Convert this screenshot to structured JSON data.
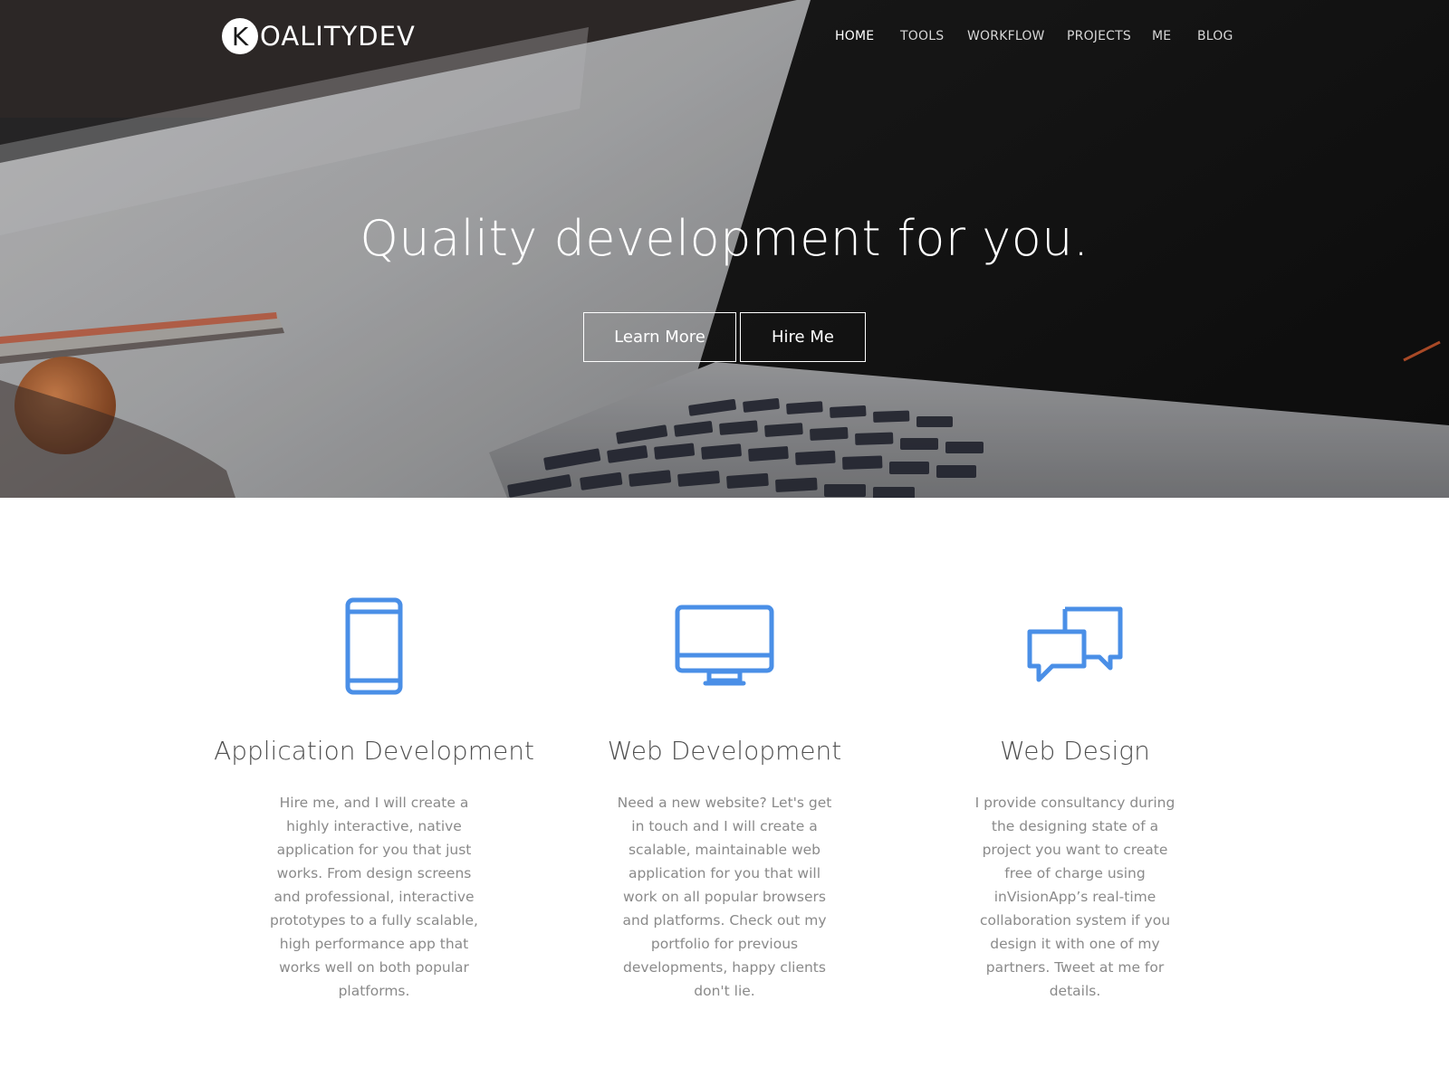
{
  "brand": {
    "logo_letter": "K",
    "logo_text": "OALITYDEV"
  },
  "nav": {
    "items": [
      "HOME",
      "TOOLS",
      "WORKFLOW",
      "PROJECTS",
      "ME",
      "BLOG"
    ],
    "active": "HOME"
  },
  "hero": {
    "headline": "Quality development for you.",
    "learn_more_label": "Learn More",
    "hire_me_label": "Hire Me"
  },
  "services": [
    {
      "icon": "mobile-phone-icon",
      "title": "Application Development",
      "text": "Hire me, and I will create a highly interactive, native application for you that just works. From design screens and professional, interactive prototypes to a fully scalable, high performance app that works well on both popular platforms."
    },
    {
      "icon": "desktop-monitor-icon",
      "title": "Web Development",
      "text": "Need a new website? Let's get in touch and I will create a scalable, maintainable web application for you that will work on all popular browsers and platforms. Check out my portfolio for previous developments, happy clients don't lie."
    },
    {
      "icon": "chat-bubbles-icon",
      "title": "Web Design",
      "text": "I provide consultancy during the designing state of a project you want to create free of charge using inVisionApp’s real-time collaboration system if you design it with one of my partners. Tweet at me for details."
    }
  ],
  "colors": {
    "accent": "#4a8fe7",
    "title_text": "#4f4f4f",
    "body_text": "#8a8a8a",
    "hero_text": "#ffffff"
  }
}
